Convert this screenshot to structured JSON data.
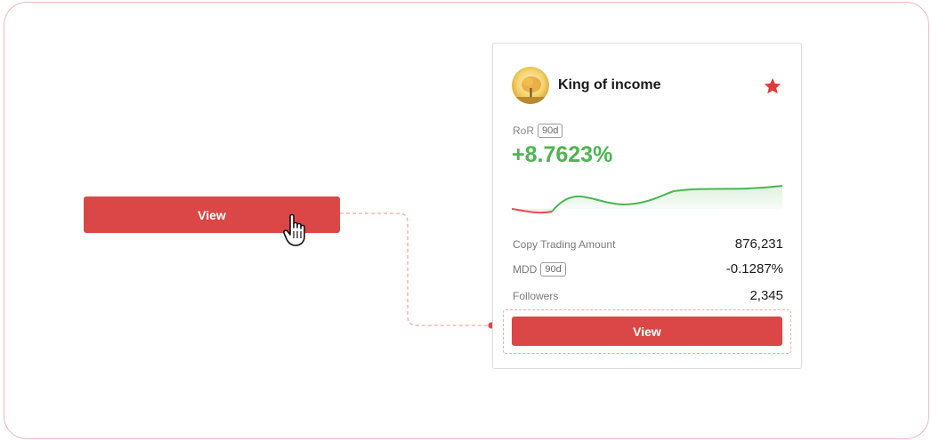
{
  "left_button": {
    "label": "View"
  },
  "card": {
    "trader_name": "King of income",
    "ror": {
      "label": "RoR",
      "period": "90d",
      "value": "+8.7623%"
    },
    "stats": [
      {
        "label": "Copy Trading Amount",
        "period": "",
        "value": "876,231"
      },
      {
        "label": "MDD",
        "period": "90d",
        "value": "-0.1287%"
      },
      {
        "label": "Followers",
        "period": "",
        "value": "2,345"
      }
    ],
    "view_label": "View"
  },
  "icons": {
    "favorite": "star-icon",
    "cursor": "hand-pointer-icon",
    "avatar": "autumn-tree-avatar"
  },
  "colors": {
    "brand_red": "#db4646",
    "positive_green": "#4cb550",
    "negative_red": "#e05050",
    "guide_pink": "#f2a6a6"
  }
}
